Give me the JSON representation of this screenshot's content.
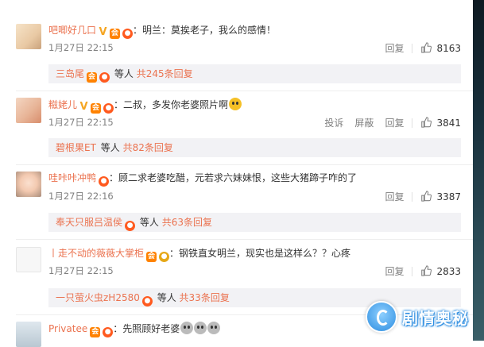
{
  "comments": [
    {
      "user": "吧唧好几口",
      "text": "：明兰：莫挨老子，我么的感情！",
      "time": "1月27日 22:15",
      "reply_label": "回复",
      "likes": "8163",
      "reply_preview": {
        "user": "三岛尾",
        "wait": "等人",
        "more": "共245条回复"
      }
    },
    {
      "user": "糍姥儿",
      "text": "：二叔，多发你老婆照片啊",
      "time": "1月27日 22:15",
      "report_label": "投诉",
      "block_label": "屏蔽",
      "reply_label": "回复",
      "likes": "3841",
      "reply_preview": {
        "user": "碧根果ET",
        "wait": "等人",
        "more": "共82条回复"
      }
    },
    {
      "user": "哇咔咔冲鸭",
      "text": "：顾二求老婆吃醋，元若求六妹妹恨，这些大猪蹄子咋的了",
      "time": "1月27日 22:16",
      "reply_label": "回复",
      "likes": "3387",
      "reply_preview": {
        "user": "奉天只服吕温侯",
        "wait": "等人",
        "more": "共63条回复"
      }
    },
    {
      "user": "丨走不动的薇薇大掌柜",
      "text": "：钢铁直女明兰，现实也是这样么？？心疼",
      "time": "1月27日 22:15",
      "reply_label": "回复",
      "likes": "2833",
      "reply_preview": {
        "user": "一只萤火虫zH2580",
        "wait": "等人",
        "more": "共33条回复"
      }
    },
    {
      "user": "Privatee",
      "text": "：先照顾好老婆"
    }
  ],
  "watermark": {
    "text": "剧情奥秘"
  },
  "colors": {
    "username": "#eb7350",
    "meta": "#808080",
    "reply_bg": "#f2f2f5"
  }
}
